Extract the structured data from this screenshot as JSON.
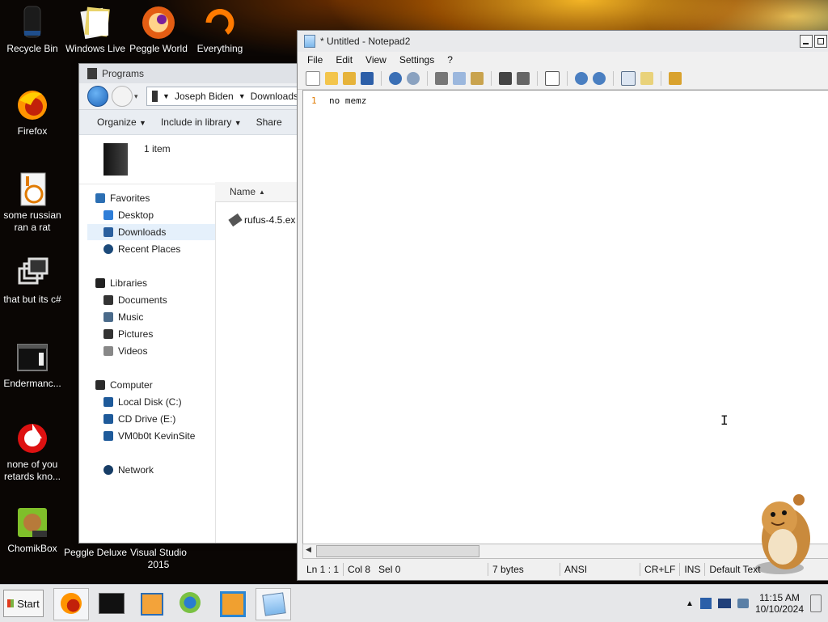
{
  "desktop": {
    "icons": [
      {
        "label": "Recycle Bin",
        "icon": "recycle-bin-icon"
      },
      {
        "label": "Windows Live",
        "icon": "windows-live-icon"
      },
      {
        "label": "Peggle World",
        "icon": "peggle-world-icon"
      },
      {
        "label": "Everything",
        "icon": "everything-icon"
      },
      {
        "label": "Firefox",
        "icon": "firefox-icon"
      },
      {
        "label": "some russian ran a rat",
        "icon": "java-file-icon"
      },
      {
        "label": "that but its c#",
        "icon": "windows-stack-icon"
      },
      {
        "label": "Endermanc...",
        "icon": "console-icon"
      },
      {
        "label": "none of you retards kno...",
        "icon": "red-logo-icon"
      },
      {
        "label": "ChomikBox",
        "icon": "chomikbox-icon"
      },
      {
        "label": "Peggle Deluxe",
        "icon": "peggle-icon"
      },
      {
        "label": "Visual Studio 2015",
        "icon": "visual-studio-icon"
      }
    ]
  },
  "explorer": {
    "title": "Programs",
    "breadcrumb": [
      "Joseph Biden",
      "Downloads"
    ],
    "commands": [
      "Organize",
      "Include in library",
      "Share"
    ],
    "item_count": "1 item",
    "nav": {
      "favorites": "Favorites",
      "favorites_items": [
        "Desktop",
        "Downloads",
        "Recent Places"
      ],
      "libraries": "Libraries",
      "libraries_items": [
        "Documents",
        "Music",
        "Pictures",
        "Videos"
      ],
      "computer": "Computer",
      "computer_items": [
        "Local Disk (C:)",
        "CD Drive (E:)",
        "VM0b0t KevinSite"
      ],
      "network": "Network"
    },
    "column_name": "Name",
    "files": [
      "rufus-4.5.ex"
    ]
  },
  "notepad": {
    "title": "* Untitled - Notepad2",
    "menu": [
      "File",
      "Edit",
      "View",
      "Settings",
      "?"
    ],
    "line_number": "1",
    "text": "no memz",
    "status": {
      "position": "Ln 1 : 1",
      "col": "Col 8",
      "sel": "Sel 0",
      "size": "7 bytes",
      "encoding": "ANSI",
      "eol": "CR+LF",
      "mode": "INS",
      "scheme": "Default Text"
    }
  },
  "taskbar": {
    "start_label": "Start",
    "apps": [
      "firefox-icon",
      "console-icon",
      "media-player-icon",
      "internet-explorer-icon",
      "windows-frame-icon",
      "notepad-icon"
    ],
    "time": "11:15 AM",
    "date": "10/10/2024"
  },
  "colors": {
    "accent_orange": "#e07a00",
    "explorer_selection": "#e5f0fb"
  }
}
